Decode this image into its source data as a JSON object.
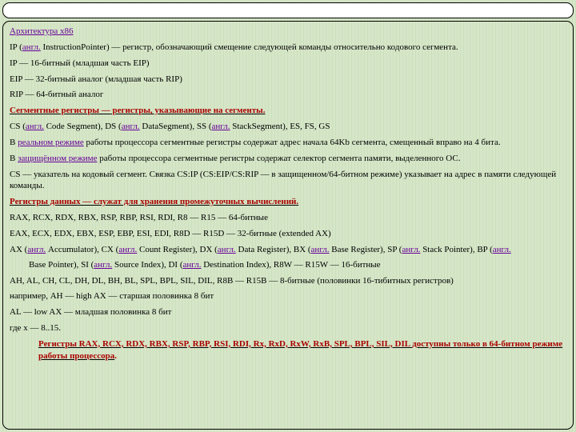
{
  "title": "Архитектура x86",
  "engl": "англ.",
  "ip_line_a": "IP (",
  "ip_line_b": " InstructionPointer) — регистр, обозначающий смещение следующей команды относительно кодового сегмента.",
  "ip16": "IP — 16-битный (младшая часть EIP)",
  "eip": "EIP — 32-битный аналог (младшая часть RIP)",
  "rip": "RIP — 64-битный аналог",
  "seg_head_a": "Сегментные регистры",
  "seg_head_b": "  — регистры, указывающие на сегменты.",
  "seg_list_a": "CS (",
  "seg_list_b": " Code Segment), DS (",
  "seg_list_c": " DataSegment), SS (",
  "seg_list_d": " StackSegment), ES, FS, GS",
  "real_a": "В ",
  "real_link": "реальном режиме",
  "real_b": " работы процессора сегментные регистры содержат адрес начала 64Kb сегмента, смещенный вправо на 4 бита.",
  "prot_a": "В ",
  "prot_link": "защищённом режиме",
  "prot_b": " работы процессора сегментные регистры содержат селектор сегмента памяти, выделенного ОС.",
  "cs_ptr": "CS — указатель на кодовый сегмент. Связка CS:IP (CS:EIP/CS:RIP — в защищенном/64-битном режиме) указывает на адрес в памяти следующей команды.",
  "data_head_a": "Регистры данных",
  "data_head_b": "  — служат для хранения промежуточных вычислений.",
  "rax64": "RAX, RCX, RDX, RBX, RSP, RBP, RSI, RDI, R8 — R15 — 64-битные",
  "eax32": "EAX, ECX, EDX, EBX, ESP, EBP, ESI, EDI, R8D — R15D  — 32-битные (extended AX)",
  "ax16_a": "AX (",
  "ax16_b": " Accumulator), CX (",
  "ax16_c": " Count Register), DX (",
  "ax16_d": " Data Register), BX (",
  "ax16_e": " Base Register), SP (",
  "ax16_f": " Stack Pointer), BP (",
  "ax16_g": " Base Pointer), SI (",
  "ax16_h": " Source Index), DI (",
  "ax16_i": " Destination Index), R8W — R15W — 16-битные",
  "ah8": "AH, AL, CH, CL, DH, DL, BH, BL, SPL, BPL, SIL, DIL, R8B — R15B — 8-битные (половинки 16-тибитных регистров)",
  "ah_ex": "например, AH — high AX — старшая половинка 8 бит",
  "al_ex": "AL — low AX — младшая половинка 8 бит",
  "x_ex": "где x — 8..15.",
  "note64_a": "Регистры RAX, RCX, RDX, RBX, RSP, RBP, RSI, RDI, Rx, RxD, RxW, RxB, SPL, BPL, SIL, DIL ",
  "note64_b": "доступны только в 64-битном режиме работы процессора",
  "note64_c": "."
}
